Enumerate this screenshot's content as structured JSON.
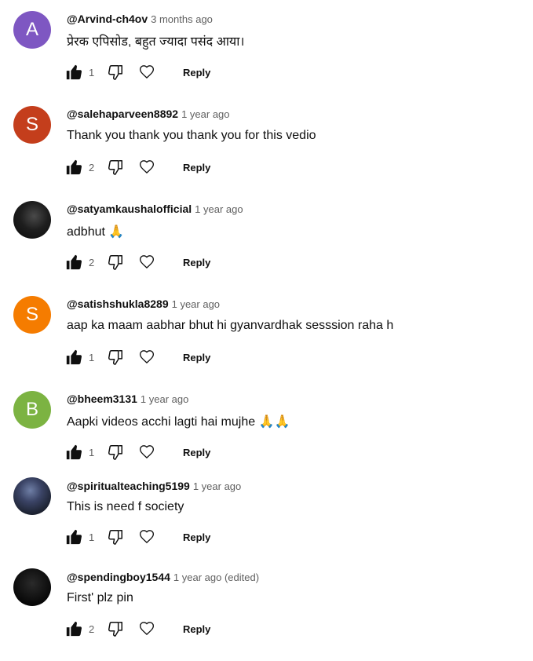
{
  "comments": [
    {
      "avatar_letter": "A",
      "avatar_color": "#7e57c2",
      "author": "@Arvind-ch4ov",
      "time": "3 months ago",
      "text": "प्रेरक एपिसोड, बहुत ज्यादा पसंद आया।",
      "likes": "1",
      "reply": "Reply"
    },
    {
      "avatar_letter": "S",
      "avatar_color": "#c43e1c",
      "author": "@salehaparveen8892",
      "time": "1 year ago",
      "text": "Thank you thank you thank you for this vedio",
      "likes": "2",
      "reply": "Reply"
    },
    {
      "avatar_letter": "",
      "avatar_color": "#111111",
      "author": "@satyamkaushalofficial",
      "time": "1 year ago",
      "text": "adbhut 🙏",
      "likes": "2",
      "reply": "Reply"
    },
    {
      "avatar_letter": "S",
      "avatar_color": "#f57c00",
      "author": "@satishshukla8289",
      "time": "1 year ago",
      "text": "aap ka maam aabhar bhut hi gyanvardhak sesssion raha h",
      "likes": "1",
      "reply": "Reply"
    },
    {
      "avatar_letter": "B",
      "avatar_color": "#7cb342",
      "author": "@bheem3131",
      "time": "1 year ago",
      "text": "Aapki videos acchi lagti hai mujhe 🙏🙏",
      "likes": "1",
      "reply": "Reply"
    },
    {
      "avatar_letter": "",
      "avatar_color": "#2b2b3a",
      "author": "@spiritualteaching5199",
      "time": "1 year ago",
      "text": "This is need f society",
      "likes": "1",
      "reply": "Reply"
    },
    {
      "avatar_letter": "",
      "avatar_color": "#000000",
      "author": "@spendingboy1544",
      "time": "1 year ago (edited)",
      "text": "First' plz pin",
      "likes": "2",
      "reply": "Reply"
    }
  ]
}
